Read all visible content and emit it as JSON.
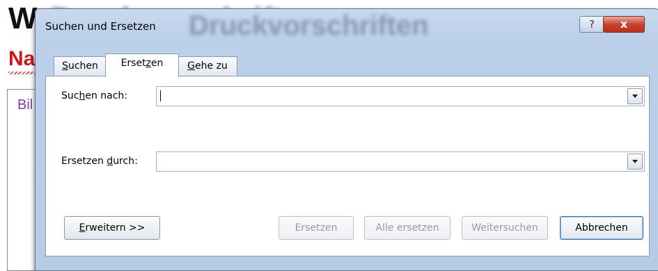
{
  "background_document": {
    "title": "W",
    "title_blurred": "Druckvorschriften",
    "subtitle": "Na",
    "box_text": "Bil"
  },
  "dialog": {
    "title": "Suchen und Ersetzen",
    "title_blur_text": "Druckvorschriften",
    "help_label": "?",
    "close_label": "x",
    "tabs": [
      {
        "pre": "",
        "u": "S",
        "post": "uchen",
        "active": false
      },
      {
        "pre": "Erset",
        "u": "z",
        "post": "en",
        "active": true
      },
      {
        "pre": "",
        "u": "G",
        "post": "ehe zu",
        "active": false
      }
    ],
    "find": {
      "pre": "Suc",
      "u": "h",
      "post": "en nach:",
      "value": ""
    },
    "replace": {
      "pre": "Ersetzen ",
      "u": "d",
      "post": "urch:",
      "value": ""
    },
    "buttons": {
      "more": {
        "pre": "",
        "u": "E",
        "post": "rweitern >>"
      },
      "replace": "Ersetzen",
      "replace_all": "Alle ersetzen",
      "find_next": "Weitersuchen",
      "cancel": "Abbrechen"
    }
  }
}
